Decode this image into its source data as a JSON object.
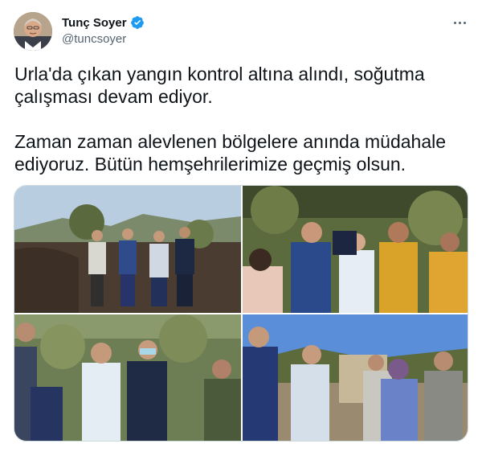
{
  "author": {
    "display_name": "Tunç Soyer",
    "handle": "@tuncsoyer",
    "verified": true
  },
  "tweet": {
    "paragraph_1": "Urla'da çıkan yangın kontrol altına alındı, soğutma çalışması devam ediyor.",
    "paragraph_2": "Zaman zaman alevlenen bölgelere anında müdahale ediyoruz. Bütün hemşehrilerimize geçmiş olsun."
  },
  "media": {
    "photo_count": 4
  },
  "icons": {
    "verified": "verified-badge-icon",
    "more": "more-options-icon"
  },
  "colors": {
    "verified_blue": "#1d9bf0",
    "text_primary": "#0f1419",
    "text_secondary": "#536471"
  }
}
